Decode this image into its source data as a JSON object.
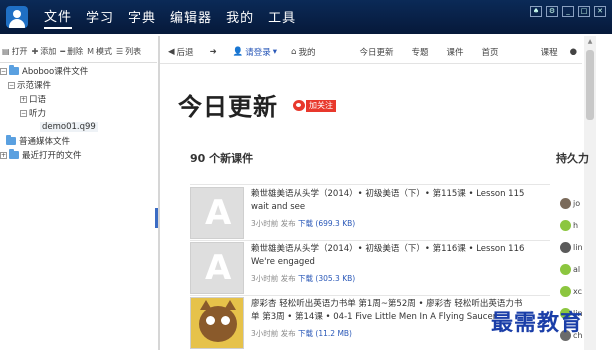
{
  "menubar": {
    "items": [
      "文件",
      "学习",
      "字典",
      "编辑器",
      "我的",
      "工具"
    ],
    "active_index": 0
  },
  "left_toolbar": {
    "open": "打开",
    "add": "添加",
    "delete": "删除",
    "mode": "模式",
    "list": "列表"
  },
  "tree": {
    "root": "Aboboo课件文件",
    "sample": "示范课件",
    "oral": "口语",
    "listening": "听力",
    "demo": "demo01.q99",
    "ordinary": "普通媒体文件",
    "recent": "最近打开的文件"
  },
  "navbar": {
    "back": "后退",
    "forward": "",
    "login": "请登录",
    "my": "我的",
    "today": "今日更新",
    "topics": "专题",
    "courses": "课件",
    "home": "首页",
    "courses2": "课程"
  },
  "page": {
    "title": "今日更新",
    "follow": "加关注",
    "count": "90 个新课件",
    "right_heading": "持久力"
  },
  "courses": [
    {
      "title": "赖世雄美语从头学（2014）• 初级美语（下）• 第115课 • Lesson 115",
      "subtitle": "wait and see",
      "time": "3小时前 发布",
      "download": "下载 (699.3 KB)",
      "thumb_letter": "A"
    },
    {
      "title": "赖世雄美语从头学（2014）• 初级美语（下）• 第116课 • Lesson 116",
      "subtitle": "We're engaged",
      "time": "3小时前 发布",
      "download": "下载 (305.3 KB)",
      "thumb_letter": "A"
    },
    {
      "title": "廖彩杏 轻松听出英语力书单 第1周~第52周 • 廖彩杏 轻松听出英语力书",
      "subtitle": "单 第3周 • 第14课 • 04-1 Five Little Men In A Flying Saucer",
      "time": "3小时前 发布",
      "download": "下载 (11.2 MB)",
      "thumb_letter": ""
    }
  ],
  "users": [
    "jo",
    "h",
    "lin",
    "al",
    "xc",
    "lin",
    "ch"
  ],
  "watermark": "最需教育",
  "colors": {
    "menubar_bg": "#0b2a57",
    "link": "#2a58b8",
    "follow_red": "#e8382c",
    "watermark": "#1a3ea8"
  }
}
